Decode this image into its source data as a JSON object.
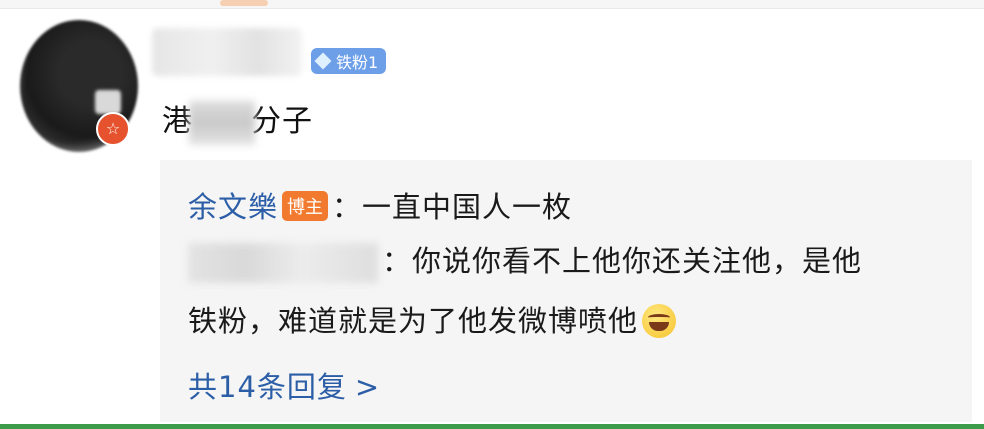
{
  "comment": {
    "fan_badge_label": "铁粉1",
    "text_prefix": "港",
    "text_suffix": "分子",
    "avatar_badge_icon": "star-icon"
  },
  "replies": {
    "reply1": {
      "name": "余文樂",
      "badge": "博主",
      "text": "：一直中国人一枚"
    },
    "reply2": {
      "text_line1": "：你说你看不上他你还关注他，是他",
      "text_line2": "铁粉，难道就是为了他发微博喷他",
      "emoji": "laughing-tears-emoji"
    },
    "more_label": "共14条回复",
    "more_chevron": ">"
  },
  "colors": {
    "link_blue": "#2c5ea8",
    "host_badge_orange": "#f27a2f",
    "fan_badge_blue": "#6d9fe9",
    "avatar_badge_red": "#e5522d",
    "reply_bg": "#f5f5f5"
  }
}
